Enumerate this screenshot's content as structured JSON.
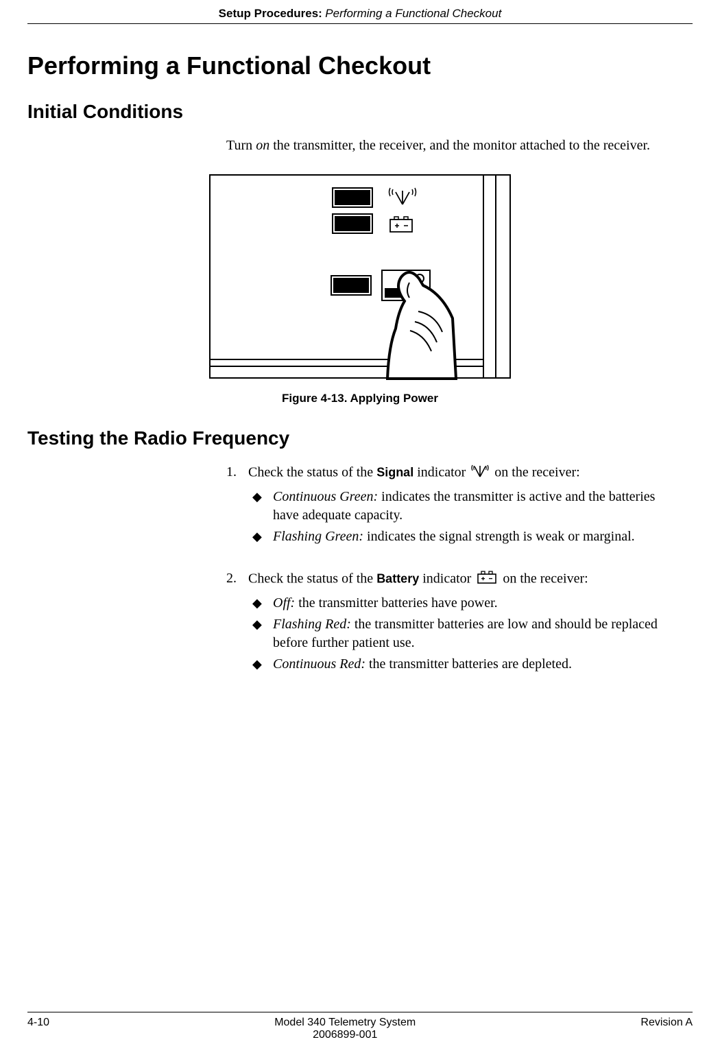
{
  "header": {
    "chapter": "Setup Procedures:",
    "subtitle": "Performing a Functional Checkout"
  },
  "title": "Performing a Functional Checkout",
  "sections": {
    "initial": {
      "heading": "Initial Conditions",
      "body_pre": "Turn ",
      "body_em": "on",
      "body_post": " the transmitter, the receiver, and the monitor attached to the receiver."
    },
    "figure": {
      "caption": "Figure 4-13.  Applying Power"
    },
    "testing": {
      "heading": "Testing the Radio Frequency",
      "steps": [
        {
          "num": "1.",
          "pre": "Check the status of the ",
          "bold": "Signal",
          "mid": " indicator ",
          "post": " on the receiver:",
          "bullets": [
            {
              "em": "Continuous Green:",
              "rest": " indicates the transmitter is active and the batteries have adequate capacity."
            },
            {
              "em": "Flashing Green:",
              "rest": " indicates the signal strength is weak or marginal."
            }
          ]
        },
        {
          "num": "2.",
          "pre": "Check the status of the ",
          "bold": "Battery",
          "mid": " indicator ",
          "post": " on the receiver:",
          "bullets": [
            {
              "em": "Off:",
              "rest": " the transmitter batteries have power."
            },
            {
              "em": "Flashing Red:",
              "rest": " the transmitter batteries are low and should be replaced before further patient use."
            },
            {
              "em": "Continuous Red:",
              "rest": " the transmitter batteries are depleted."
            }
          ]
        }
      ]
    }
  },
  "footer": {
    "left": "4-10",
    "center1": "Model 340 Telemetry System",
    "center2": "2006899-001",
    "right": "Revision A"
  }
}
